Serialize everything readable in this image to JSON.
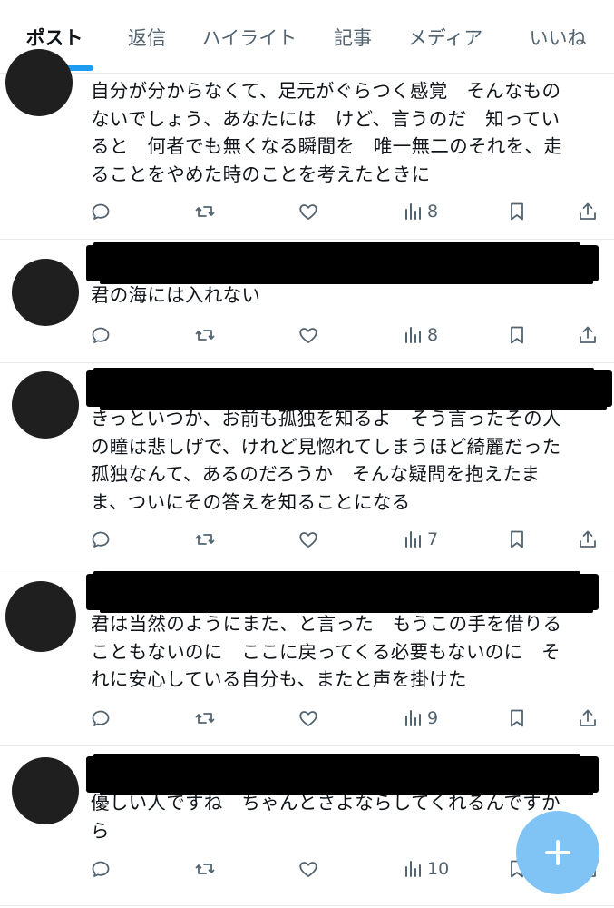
{
  "tabs": [
    {
      "label": "ポスト",
      "active": true
    },
    {
      "label": "返信",
      "active": false
    },
    {
      "label": "ハイライト",
      "active": false
    },
    {
      "label": "記事",
      "active": false
    },
    {
      "label": "メディア",
      "active": false
    },
    {
      "label": "いいね",
      "active": false
    }
  ],
  "colors": {
    "accent": "#1d9bf0",
    "text": "#0f1419",
    "muted": "#536471",
    "fab": "#7fc4f5"
  },
  "posts": [
    {
      "text": "自分が分からなくて、足元がぐらつく感覚　そんなもの\nないでしょう、あなたには　けど、言うのだ　知ってい\nると　何者でも無くなる瞬間を　唯一無二のそれを、走\nることをやめた時のことを考えたときに",
      "views": "8"
    },
    {
      "text": "君の海には入れない",
      "views": "8"
    },
    {
      "text": "きっといつか、お前も孤独を知るよ　そう言ったその人\nの瞳は悲しげで、けれど見惚れてしまうほど綺麗だった\n孤独なんて、あるのだろうか　そんな疑問を抱えたま\nま、ついにその答えを知ることになる",
      "views": "7"
    },
    {
      "text": "君は当然のようにまた、と言った　もうこの手を借りる\nこともないのに　ここに戻ってくる必要もないのに　そ\nれに安心している自分も、またと声を掛けた",
      "views": "9"
    },
    {
      "text": "優しい人ですね　ちゃんとさよならしてくれるんですか\nら",
      "views": "10"
    }
  ],
  "icons": {
    "reply": "reply-icon",
    "repost": "repost-icon",
    "like": "like-icon",
    "views": "views-icon",
    "bookmark": "bookmark-icon",
    "share": "share-icon",
    "compose": "compose-plus-icon"
  }
}
